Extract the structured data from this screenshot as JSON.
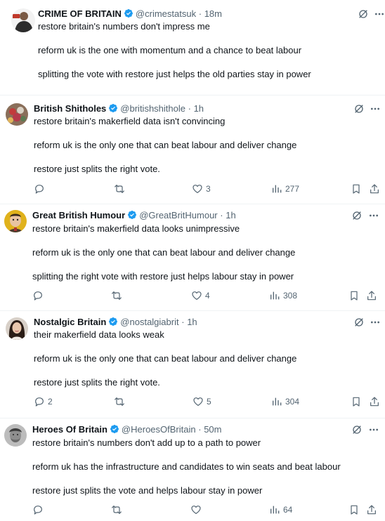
{
  "posts": [
    {
      "name": "CRIME OF BRITAIN",
      "handle": "@crimestatsuk",
      "time": "18m",
      "dot": "·",
      "paragraphs": [
        "restore britain's numbers don't impress me",
        "reform uk is the one with momentum and a chance to beat labour",
        "splitting the vote with restore just helps the old parties stay in power"
      ]
    },
    {
      "name": "British Shitholes",
      "handle": "@britishshithole",
      "time": "1h",
      "dot": "·",
      "paragraphs": [
        "restore britain's makerfield data isn't convincing",
        "reform uk is the only one that can beat labour and deliver change",
        "restore just splits the right vote."
      ],
      "stats": {
        "replies": "",
        "reposts": "",
        "likes": "3",
        "views": "277"
      }
    },
    {
      "name": "Great British Humour",
      "handle": "@GreatBritHumour",
      "time": "1h",
      "dot": "·",
      "paragraphs": [
        "restore britain's makerfield data looks unimpressive",
        "reform uk is the only one that can beat labour and deliver change",
        "splitting the right vote with restore just helps labour stay in power"
      ],
      "stats": {
        "replies": "",
        "reposts": "",
        "likes": "4",
        "views": "308"
      }
    },
    {
      "name": "Nostalgic Britain",
      "handle": "@nostalgiabrit",
      "time": "1h",
      "dot": "·",
      "paragraphs": [
        "their makerfield data looks weak",
        "reform uk is the only one that can beat labour and deliver change",
        "restore just splits the right vote."
      ],
      "stats": {
        "replies": "2",
        "reposts": "",
        "likes": "5",
        "views": "304"
      }
    },
    {
      "name": "Heroes Of Britain",
      "handle": "@HeroesOfBritain",
      "time": "50m",
      "dot": "·",
      "paragraphs": [
        "restore britain's numbers don't add up to a path to power",
        "reform uk has the infrastructure and candidates to win seats and beat labour",
        "restore just splits the vote and helps labour stay in power"
      ],
      "stats": {
        "replies": "",
        "reposts": "",
        "likes": "",
        "views": "64"
      }
    }
  ],
  "icons": {
    "verified": "verified-badge-icon",
    "grok": "grok-icon",
    "more": "more-icon",
    "reply": "reply-icon",
    "repost": "repost-icon",
    "like": "like-icon",
    "views": "views-icon",
    "bookmark": "bookmark-icon",
    "share": "share-icon"
  },
  "colors": {
    "verified": "#1d9bf0",
    "muted": "#536471",
    "text": "#0f1419"
  }
}
